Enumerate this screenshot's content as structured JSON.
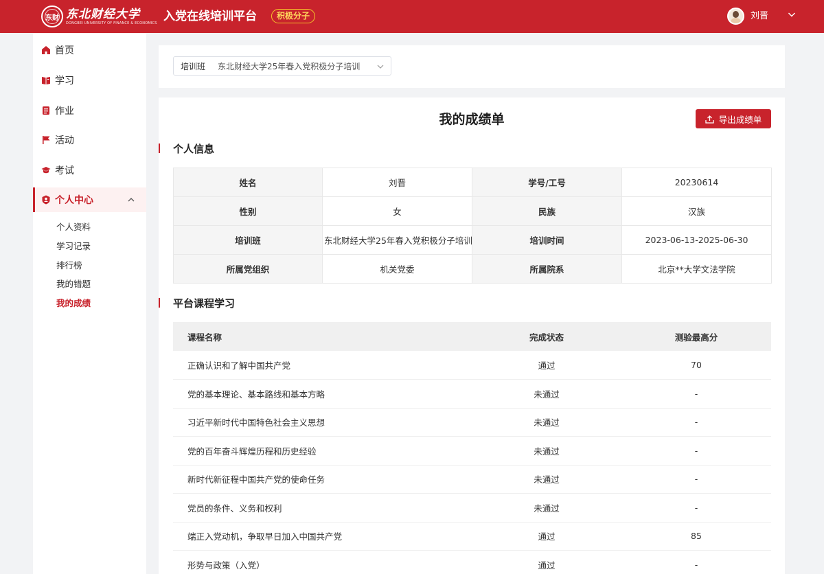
{
  "header": {
    "logo_cn": "东北财经大学",
    "logo_en": "DONGBEI UNIVERSITY OF FINANCE & ECONOMICS",
    "logo_seal": "东财",
    "platform_title": "入党在线培训平台",
    "role_badge": "积极分子",
    "user_name": "刘晋",
    "brand_color": "#c8232c"
  },
  "sidebar": {
    "items": [
      {
        "label": "首页",
        "icon": "home-icon"
      },
      {
        "label": "学习",
        "icon": "book-icon"
      },
      {
        "label": "作业",
        "icon": "homework-icon"
      },
      {
        "label": "活动",
        "icon": "flag-icon"
      },
      {
        "label": "考试",
        "icon": "graduation-cap-icon"
      },
      {
        "label": "个人中心",
        "icon": "user-icon",
        "expanded": true
      }
    ],
    "sub_items": [
      "个人资料",
      "学习记录",
      "排行榜",
      "我的错题",
      "我的成绩"
    ],
    "active_sub": "我的成绩"
  },
  "filter": {
    "label": "培训班",
    "value": "东北财经大学25年春入党积极分子培训"
  },
  "report": {
    "title": "我的成绩单",
    "export_label": "导出成绩单",
    "personal_section": "个人信息",
    "course_section": "平台课程学习",
    "info": [
      [
        "姓名",
        "刘晋",
        "学号/工号",
        "20230614"
      ],
      [
        "性别",
        "女",
        "民族",
        "汉族"
      ],
      [
        "培训班",
        "东北财经大学25年春入党积极分子培训",
        "培训时间",
        "2023-06-13-2025-06-30"
      ],
      [
        "所属党组织",
        "机关党委",
        "所属院系",
        "北京**大学文法学院"
      ]
    ],
    "course_headers": [
      "课程名称",
      "完成状态",
      "测验最高分"
    ],
    "courses": [
      [
        "正确认识和了解中国共产党",
        "通过",
        "70"
      ],
      [
        "党的基本理论、基本路线和基本方略",
        "未通过",
        "-"
      ],
      [
        "习近平新时代中国特色社会主义思想",
        "未通过",
        "-"
      ],
      [
        "党的百年奋斗辉煌历程和历史经验",
        "未通过",
        "-"
      ],
      [
        "新时代新征程中国共产党的使命任务",
        "未通过",
        "-"
      ],
      [
        "党员的条件、义务和权利",
        "未通过",
        "-"
      ],
      [
        "端正入党动机，争取早日加入中国共产党",
        "通过",
        "85"
      ],
      [
        "形势与政策（入党）",
        "通过",
        "-"
      ]
    ]
  }
}
